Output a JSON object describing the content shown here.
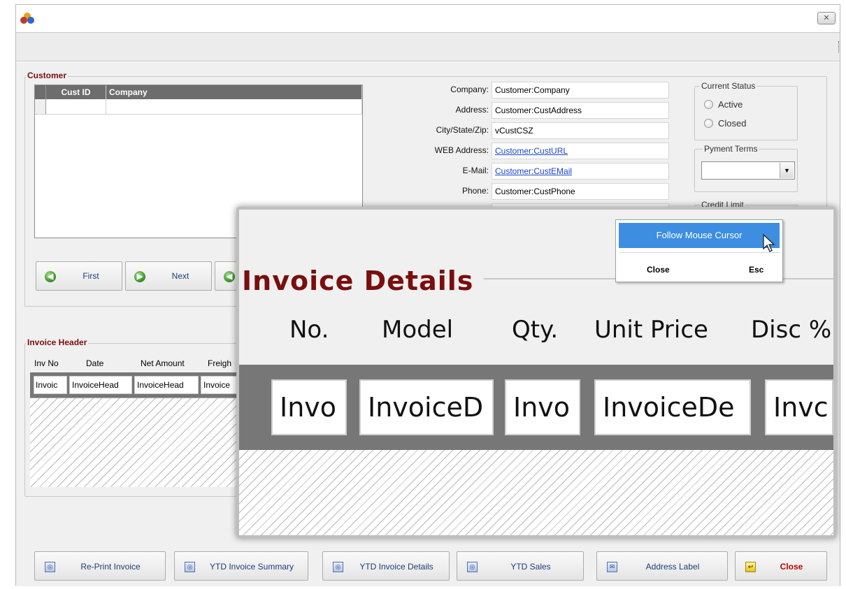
{
  "window": {
    "close_glyph": "✕"
  },
  "customer": {
    "group_title": "Customer",
    "grid": {
      "columns": [
        "Cust ID",
        "Company"
      ]
    },
    "nav": {
      "first": "First",
      "next": "Next"
    },
    "fields": [
      {
        "label": "Company:",
        "value": "Customer:Company",
        "link": false
      },
      {
        "label": "Address:",
        "value": "Customer:CustAddress",
        "link": false
      },
      {
        "label": "City/State/Zip:",
        "value": "vCustCSZ",
        "link": false
      },
      {
        "label": "WEB Address:",
        "value": "Customer:CustURL",
        "link": true
      },
      {
        "label": "E-Mail:",
        "value": "Customer:CustEMail",
        "link": true
      },
      {
        "label": "Phone:",
        "value": "Customer:CustPhone",
        "link": false
      }
    ],
    "status": {
      "title": "Current Status",
      "options": [
        "Active",
        "Closed"
      ]
    },
    "terms": {
      "title": "Pyment Terms",
      "value": ""
    },
    "credit": {
      "title": "Credit Limit"
    }
  },
  "invoice_header": {
    "group_title": "Invoice Header",
    "columns": [
      "Inv No",
      "Date",
      "Net Amount",
      "Freigh"
    ],
    "cells": [
      "Invoic",
      "InvoiceHead",
      "InvoiceHead",
      "Invoice"
    ]
  },
  "zoom": {
    "title": "Invoice Details",
    "columns": [
      "No.",
      "Model",
      "Qty.",
      "Unit Price",
      "Disc %"
    ],
    "cells": [
      "Invo",
      "InvoiceD",
      "Invo",
      "InvoiceDe",
      "Invc"
    ]
  },
  "context_menu": {
    "follow": "Follow Mouse Cursor",
    "close": "Close",
    "shortcut": "Esc"
  },
  "bottom_buttons": [
    {
      "label": "Re-Print Invoice"
    },
    {
      "label": "YTD Invoice Summary"
    },
    {
      "label": "YTD Invoice Details"
    },
    {
      "label": "YTD Sales"
    },
    {
      "label": "Address Label"
    },
    {
      "label": "Close"
    }
  ],
  "colors": {
    "accent_title": "#7a0e0e",
    "menu_highlight": "#3d8ee0",
    "link": "#1a47c7"
  }
}
